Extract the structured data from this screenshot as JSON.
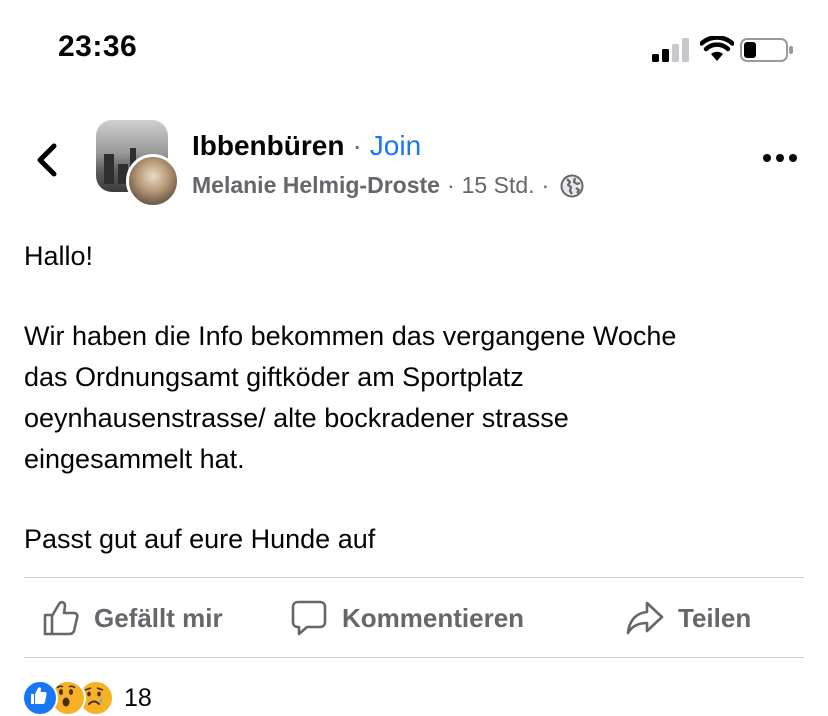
{
  "status_bar": {
    "time": "23:36"
  },
  "header": {
    "group_name": "Ibbenbüren",
    "separator": "·",
    "join_label": "Join",
    "author": "Melanie Helmig-Droste",
    "time_ago": "15 Std.",
    "privacy_icon": "globe-icon"
  },
  "post": {
    "greeting": "Hallo!",
    "lines": [
      "Wir haben die Info bekommen das vergangene Woche",
      "das Ordnungsamt giftköder am Sportplatz",
      "oeynhausenstrasse/ alte bockradener strasse",
      "eingesammelt hat."
    ],
    "closing": "Passt gut auf eure Hunde auf"
  },
  "actions": {
    "like_label": "Gefällt mir",
    "comment_label": "Kommentieren",
    "share_label": "Teilen"
  },
  "reactions": {
    "types": [
      "like-icon",
      "wow-icon",
      "sad-icon"
    ],
    "count": "18"
  },
  "colors": {
    "accent": "#1877f2",
    "secondary_text": "#65676b",
    "divider": "#ced0d4"
  }
}
